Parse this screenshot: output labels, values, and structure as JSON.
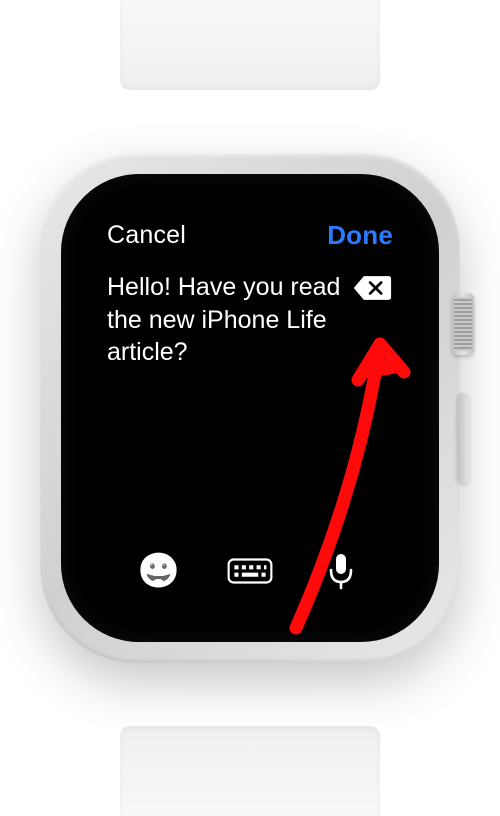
{
  "header": {
    "cancel_label": "Cancel",
    "done_label": "Done"
  },
  "message": {
    "text": "Hello! Have you read the new iPhone Life article?"
  },
  "toolbar": {
    "emoji_icon": "emoji-icon",
    "keyboard_icon": "keyboard-icon",
    "mic_icon": "mic-icon"
  },
  "colors": {
    "accent": "#2a7bff",
    "annotation": "#ff0a0a"
  }
}
